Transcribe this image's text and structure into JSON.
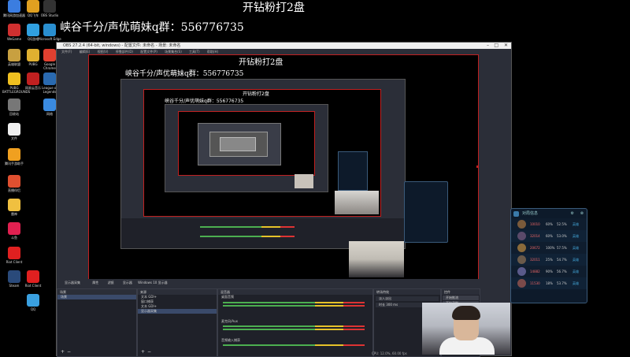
{
  "overlay": {
    "title": "开钻粉打2盘",
    "subtitle": "峡谷千分/声优萌妹q群：556776735"
  },
  "desktop_icons": [
    {
      "label": "腾讯网游加速器",
      "color": "#3b7de0"
    },
    {
      "label": "QQ飞车",
      "color": "#e0a020"
    },
    {
      "label": "OBS Studio",
      "color": "#333"
    },
    {
      "label": "WeGame",
      "color": "#d03030"
    },
    {
      "label": "QQ游戏",
      "color": "#30a0e0"
    },
    {
      "label": "Microsoft Edge",
      "color": "#2a8fd0"
    },
    {
      "label": "英雄联盟",
      "color": "#c8a040"
    },
    {
      "label": "PUBG",
      "color": "#e0b030"
    },
    {
      "label": "Google Chrome",
      "color": "#e04030"
    },
    {
      "label": "PUBG BATTLEGROUNDS",
      "color": "#f0c020"
    },
    {
      "label": "网易云音乐",
      "color": "#c02020"
    },
    {
      "label": "League of Legends",
      "color": "#2a6ab0"
    },
    {
      "label": "回收站",
      "color": "#777"
    },
    {
      "label": "网络",
      "color": "#3a8ae0"
    },
    {
      "label": "文件",
      "color": "#eee"
    },
    {
      "label": "腾讯手游助手",
      "color": "#f0a020"
    },
    {
      "label": "直播伴侣",
      "color": "#e05030"
    },
    {
      "label": "雷神",
      "color": "#f0c040"
    },
    {
      "label": "斗鱼",
      "color": "#e02050"
    },
    {
      "label": "Riot Client",
      "color": "#e02020"
    },
    {
      "label": "Steam",
      "color": "#2a4a7a"
    },
    {
      "label": "Riot Client",
      "color": "#e02020"
    },
    {
      "label": "QQ",
      "color": "#3aa0e0"
    }
  ],
  "obs": {
    "window_title": "OBS 27.2.4 (64-bit, windows) - 配置文件: 未命名 - 场景: 未命名",
    "menu": [
      "文件(F)",
      "编辑(E)",
      "视图(V)",
      "停靠部件(D)",
      "配置文件(P)",
      "场景集合(S)",
      "工具(T)",
      "帮助(H)"
    ],
    "dock_bar": [
      "显示器采集",
      "属性",
      "滤镜",
      "显示器",
      "Windows 10 显示器"
    ],
    "docks": {
      "scenes": {
        "title": "场景",
        "items": [
          "场景"
        ]
      },
      "sources": {
        "title": "来源",
        "items": [
          "文本 GDI+",
          "窗口捕获",
          "文本 GDI+",
          "显示器采集"
        ]
      },
      "mixer": {
        "title": "混音器",
        "channels": [
          "桌面音频",
          "麦克风/Aux",
          "音频输入捕获"
        ]
      },
      "transitions": {
        "title": "转场特效",
        "items": [
          "淡入淡出",
          "时长 300 ms"
        ]
      },
      "controls": {
        "title": "控件",
        "buttons": [
          "开始推流",
          "开始录制",
          "启动虚拟摄像机",
          "工作室模式",
          "设置",
          "退出"
        ]
      }
    },
    "status": "CPU: 12.0%, 60.00 fps"
  },
  "match_panel": {
    "title": "对局信息",
    "rows": [
      {
        "level": "10010",
        "score": "60%",
        "tag": "英雄",
        "rate": "52.5%"
      },
      {
        "level": "32014",
        "score": "60%",
        "tag": "英雄",
        "rate": "53.0%"
      },
      {
        "level": "20672",
        "score": "100%",
        "tag": "英雄",
        "rate": "57.5%"
      },
      {
        "level": "32011",
        "score": "25%",
        "tag": "英雄",
        "rate": "54.7%"
      },
      {
        "level": "14882",
        "score": "90%",
        "tag": "英雄",
        "rate": "56.7%"
      },
      {
        "level": "11530",
        "score": "18%",
        "tag": "英雄",
        "rate": "53.7%"
      }
    ]
  },
  "colors": {
    "preview_border": "#c02020",
    "accent": "#4caf50"
  }
}
